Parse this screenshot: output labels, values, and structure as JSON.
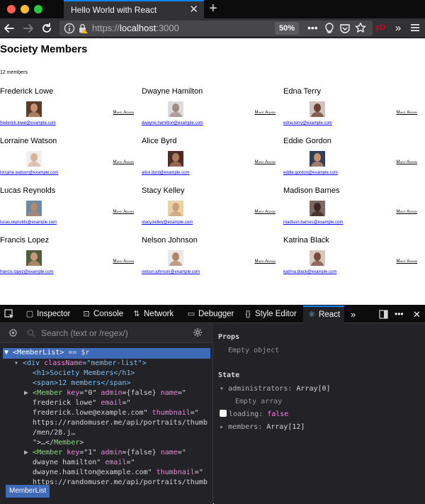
{
  "browser": {
    "tab_title": "Hello World with React",
    "url_scheme": "https://",
    "url_host": "localhost",
    "url_port": ":3000",
    "zoom": "50%"
  },
  "page": {
    "title": "Society Members",
    "member_count": "12 members",
    "members": [
      {
        "name": "Frederick Lowe",
        "admin_label": "Make Admin",
        "email": "frederick.lowe@example.com",
        "thumb_bg": "#5a3b2b",
        "thumb_face": "#c79272"
      },
      {
        "name": "Dwayne Hamilton",
        "admin_label": "Make Admin",
        "email": "dwayne.hamilton@example.com",
        "thumb_bg": "#dcdcdc",
        "thumb_face": "#9f8c82"
      },
      {
        "name": "Edna Terry",
        "admin_label": "Make Admin",
        "email": "edna.terry@example.com",
        "thumb_bg": "#cfc4bd",
        "thumb_face": "#6b3f33"
      },
      {
        "name": "Lorraine Watson",
        "admin_label": "Make Admin",
        "email": "lorraine.watson@example.com",
        "thumb_bg": "#efefef",
        "thumb_face": "#d7b39a"
      },
      {
        "name": "Alice Byrd",
        "admin_label": "Make Admin",
        "email": "alice.byrd@example.com",
        "thumb_bg": "#4b2e25",
        "thumb_face": "#b37a62"
      },
      {
        "name": "Eddie Gordon",
        "admin_label": "Make Admin",
        "email": "eddie.gordon@example.com",
        "thumb_bg": "#2e3f5a",
        "thumb_face": "#c8926d"
      },
      {
        "name": "Lucas Reynolds",
        "admin_label": "Make Admin",
        "email": "lucas.reynolds@example.com",
        "thumb_bg": "#6a8aa6",
        "thumb_face": "#b58869"
      },
      {
        "name": "Stacy Kelley",
        "admin_label": "Make Admin",
        "email": "stacy.kelley@example.com",
        "thumb_bg": "#e9d3a5",
        "thumb_face": "#caa07f"
      },
      {
        "name": "Madison Barnes",
        "admin_label": "Make Admin",
        "email": "madison.barnes@example.com",
        "thumb_bg": "#7c6a63",
        "thumb_face": "#3e2620"
      },
      {
        "name": "Francis Lopez",
        "admin_label": "Make Admin",
        "email": "francis.lopez@example.com",
        "thumb_bg": "#4f5e3c",
        "thumb_face": "#c99677"
      },
      {
        "name": "Nelson Johnson",
        "admin_label": "Make Admin",
        "email": "nelson.johnson@example.com",
        "thumb_bg": "#e8e8e8",
        "thumb_face": "#b08764"
      },
      {
        "name": "Katrina Black",
        "admin_label": "Make Admin",
        "email": "katrina.black@example.com",
        "thumb_bg": "#d9c7bd",
        "thumb_face": "#7a4a3a"
      }
    ]
  },
  "devtools": {
    "tabs": {
      "inspector": "Inspector",
      "console": "Console",
      "network": "Network",
      "debugger": "Debugger",
      "style_editor": "Style Editor",
      "react": "React"
    },
    "search_placeholder": "Search (text or /regex/)",
    "tree": {
      "root_tag": "<MemberList>",
      "root_suffix": " == $r",
      "div_open": "<div ",
      "div_attr": "className",
      "div_val": "=\"member-list\">",
      "h1": "<h1>Society Members</h1>",
      "span": "<span>12 members</span>",
      "m0_l1_tag": "<Member ",
      "m0_l1_key": "key",
      "m0_l1_keyval": "=\"0\" ",
      "m0_l1_admin": "admin",
      "m0_l1_adminval": "={false} ",
      "m0_l1_name": "name",
      "m0_l1_nameq": "=\"",
      "m0_l2": "frederick lowe\" ",
      "m0_l2_email": "email",
      "m0_l2_emailq": "=\"",
      "m0_l3": "frederick.lowe@example.com\" ",
      "m0_l3_thumb": "thumbnail",
      "m0_l3_thumbq": "=\"",
      "m0_l4": "https://randomuser.me/api/portraits/thumb",
      "m0_l5": "/men/28.j…",
      "m0_l6a": "\">…</",
      "m0_l6b": "Member",
      "m0_l6c": ">",
      "m1_l1_tag": "<Member ",
      "m1_l1_key": "key",
      "m1_l1_keyval": "=\"1\" ",
      "m1_l1_admin": "admin",
      "m1_l1_adminval": "={false} ",
      "m1_l1_name": "name",
      "m1_l1_nameq": "=\"",
      "m1_l2": "dwayne hamilton\" ",
      "m1_l2_email": "email",
      "m1_l2_emailq": "=\"",
      "m1_l3": "dwayne.hamilton@example.com\" ",
      "m1_l3_thumb": "thumbnail",
      "m1_l3_thumbq": "=\"",
      "m1_l4": "https://randomuser.me/api/portraits/thumb"
    },
    "breadcrumb": "MemberList",
    "props": {
      "heading": "Props",
      "empty": "Empty object"
    },
    "state": {
      "heading": "State",
      "administrators_key": "administrators",
      "administrators_val": "Array[0]",
      "administrators_empty": "Empty array",
      "loading_key": "loading",
      "loading_val": "false",
      "members_key": "members",
      "members_val": "Array[12]"
    }
  }
}
